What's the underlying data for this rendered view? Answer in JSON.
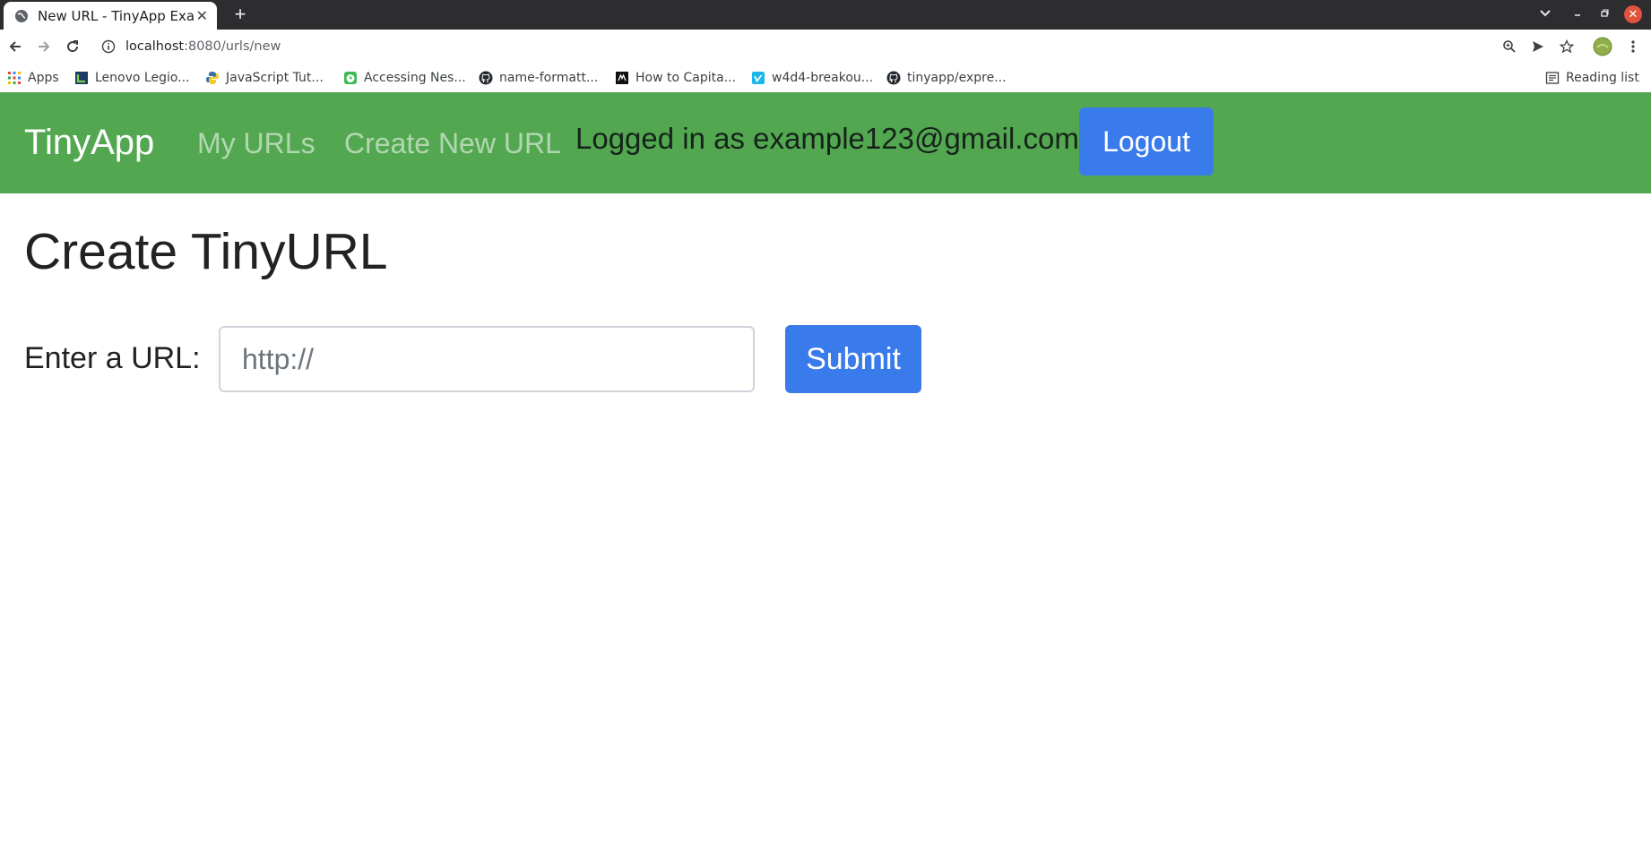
{
  "browser": {
    "tab_title": "New URL - TinyApp Example",
    "url_host": "localhost",
    "url_path": ":8080/urls/new",
    "bookmarks": [
      {
        "label": "Apps",
        "icon": "apps-grid-icon"
      },
      {
        "label": "Lenovo Legio...",
        "icon": "lenovo-icon"
      },
      {
        "label": "JavaScript Tut...",
        "icon": "python-icon"
      },
      {
        "label": "Accessing Nes...",
        "icon": "clock-icon"
      },
      {
        "label": "name-formatt...",
        "icon": "github-icon"
      },
      {
        "label": "How to Capita...",
        "icon": "site-icon"
      },
      {
        "label": "w4d4-breakou...",
        "icon": "vimeo-icon"
      },
      {
        "label": "tinyapp/expre...",
        "icon": "github-icon"
      }
    ],
    "reading_list": "Reading list"
  },
  "navbar": {
    "brand": "TinyApp",
    "links": [
      "My URLs",
      "Create New URL"
    ],
    "logged_in_text": "Logged in as example123@gmail.com!",
    "logout_label": "Logout"
  },
  "main": {
    "title": "Create TinyURL",
    "form": {
      "label": "Enter a URL:",
      "placeholder": "http://",
      "submit_label": "Submit"
    }
  },
  "colors": {
    "navbar": "#53a750",
    "primary_button": "#3a7bec"
  }
}
